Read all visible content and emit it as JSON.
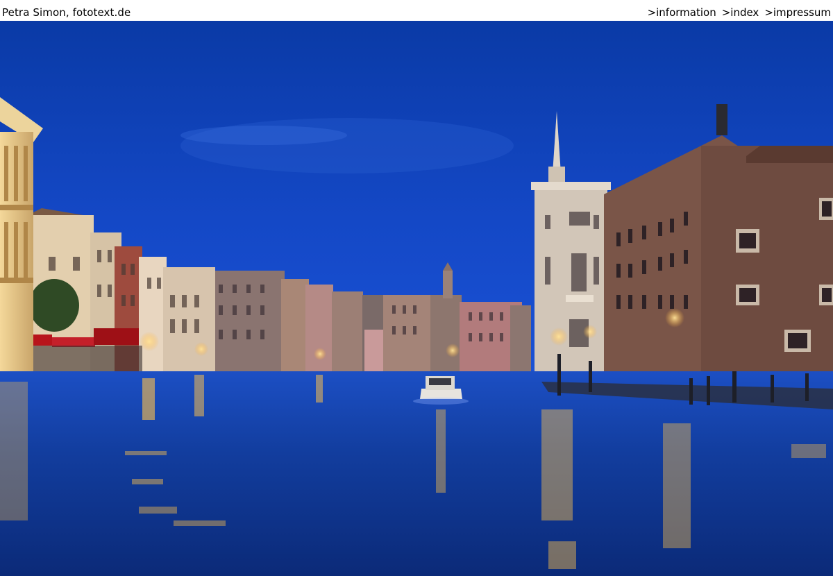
{
  "header": {
    "credit": "Petra Simon, fototext.de",
    "nav": [
      {
        "label": ">information"
      },
      {
        "label": ">index"
      },
      {
        "label": ">impressum"
      }
    ]
  },
  "photo": {
    "colors": {
      "sky_top": "#0b3fb0",
      "sky_bottom": "#1a4fd0",
      "water": "#0e2f88",
      "light": "#ffc24a"
    }
  }
}
